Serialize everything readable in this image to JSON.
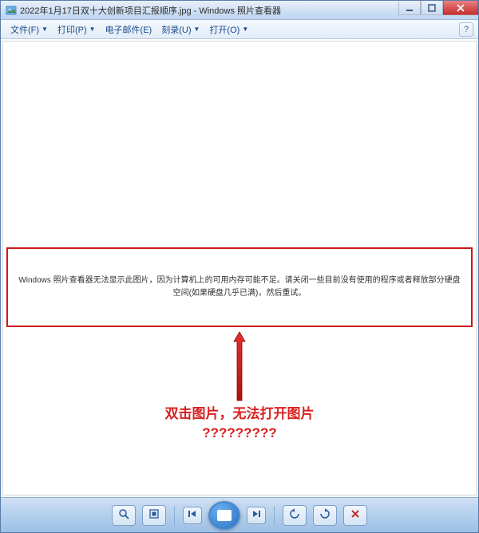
{
  "titlebar": {
    "title": "2022年1月17日双十大创新项目汇报顺序.jpg - Windows 照片查看器"
  },
  "menubar": {
    "file": "文件(F)",
    "print": "打印(P)",
    "email": "电子邮件(E)",
    "burn": "刻录(U)",
    "open": "打开(O)",
    "help": "?"
  },
  "error": {
    "message": "Windows 照片查看器无法显示此图片，因为计算机上的可用内存可能不足。请关闭一些目前没有使用的程序或者释放部分硬盘空间(如果硬盘几乎已满)，然后重试。"
  },
  "annotation": {
    "line1": "双击图片，无法打开图片",
    "line2": "?????????"
  },
  "colors": {
    "annotation_red": "#d82020",
    "error_border": "#cc1818"
  }
}
